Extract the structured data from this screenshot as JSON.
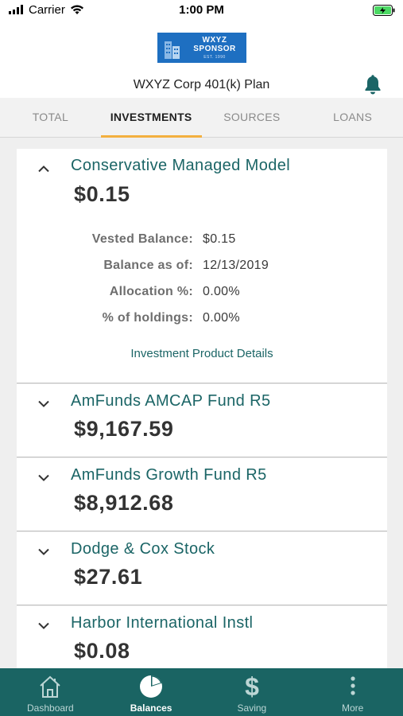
{
  "status_bar": {
    "carrier": "Carrier",
    "time": "1:00 PM"
  },
  "header": {
    "logo_line1": "WXYZ",
    "logo_line2": "SPONSOR",
    "logo_est": "EST. 1990",
    "plan_title": "WXYZ Corp 401(k) Plan"
  },
  "tabs": [
    {
      "label": "TOTAL",
      "active": false
    },
    {
      "label": "INVESTMENTS",
      "active": true
    },
    {
      "label": "SOURCES",
      "active": false
    },
    {
      "label": "LOANS",
      "active": false
    }
  ],
  "investments": [
    {
      "name": "Conservative Managed Model",
      "amount": "$0.15",
      "expanded": true,
      "details": [
        {
          "label": "Vested Balance:",
          "value": "$0.15"
        },
        {
          "label": "Balance as of:",
          "value": "12/13/2019"
        },
        {
          "label": "Allocation %:",
          "value": "0.00%"
        },
        {
          "label": "% of holdings:",
          "value": "0.00%"
        }
      ],
      "link": "Investment Product Details"
    },
    {
      "name": "AmFunds AMCAP Fund R5",
      "amount": "$9,167.59",
      "expanded": false
    },
    {
      "name": "AmFunds Growth Fund R5",
      "amount": "$8,912.68",
      "expanded": false
    },
    {
      "name": "Dodge & Cox Stock",
      "amount": "$27.61",
      "expanded": false
    },
    {
      "name": "Harbor International Instl",
      "amount": "$0.08",
      "expanded": false
    }
  ],
  "bottom_nav": [
    {
      "label": "Dashboard",
      "icon": "home-icon",
      "active": false
    },
    {
      "label": "Balances",
      "icon": "pie-chart-icon",
      "active": true
    },
    {
      "label": "Saving",
      "icon": "dollar-icon",
      "active": false
    },
    {
      "label": "More",
      "icon": "more-vertical-icon",
      "active": false
    }
  ],
  "colors": {
    "accent_teal": "#1b6566",
    "nav_bg": "#1a6463",
    "tab_indicator": "#f3b03f",
    "logo_bg": "#1e6fc1",
    "battery": "#4cd964"
  }
}
